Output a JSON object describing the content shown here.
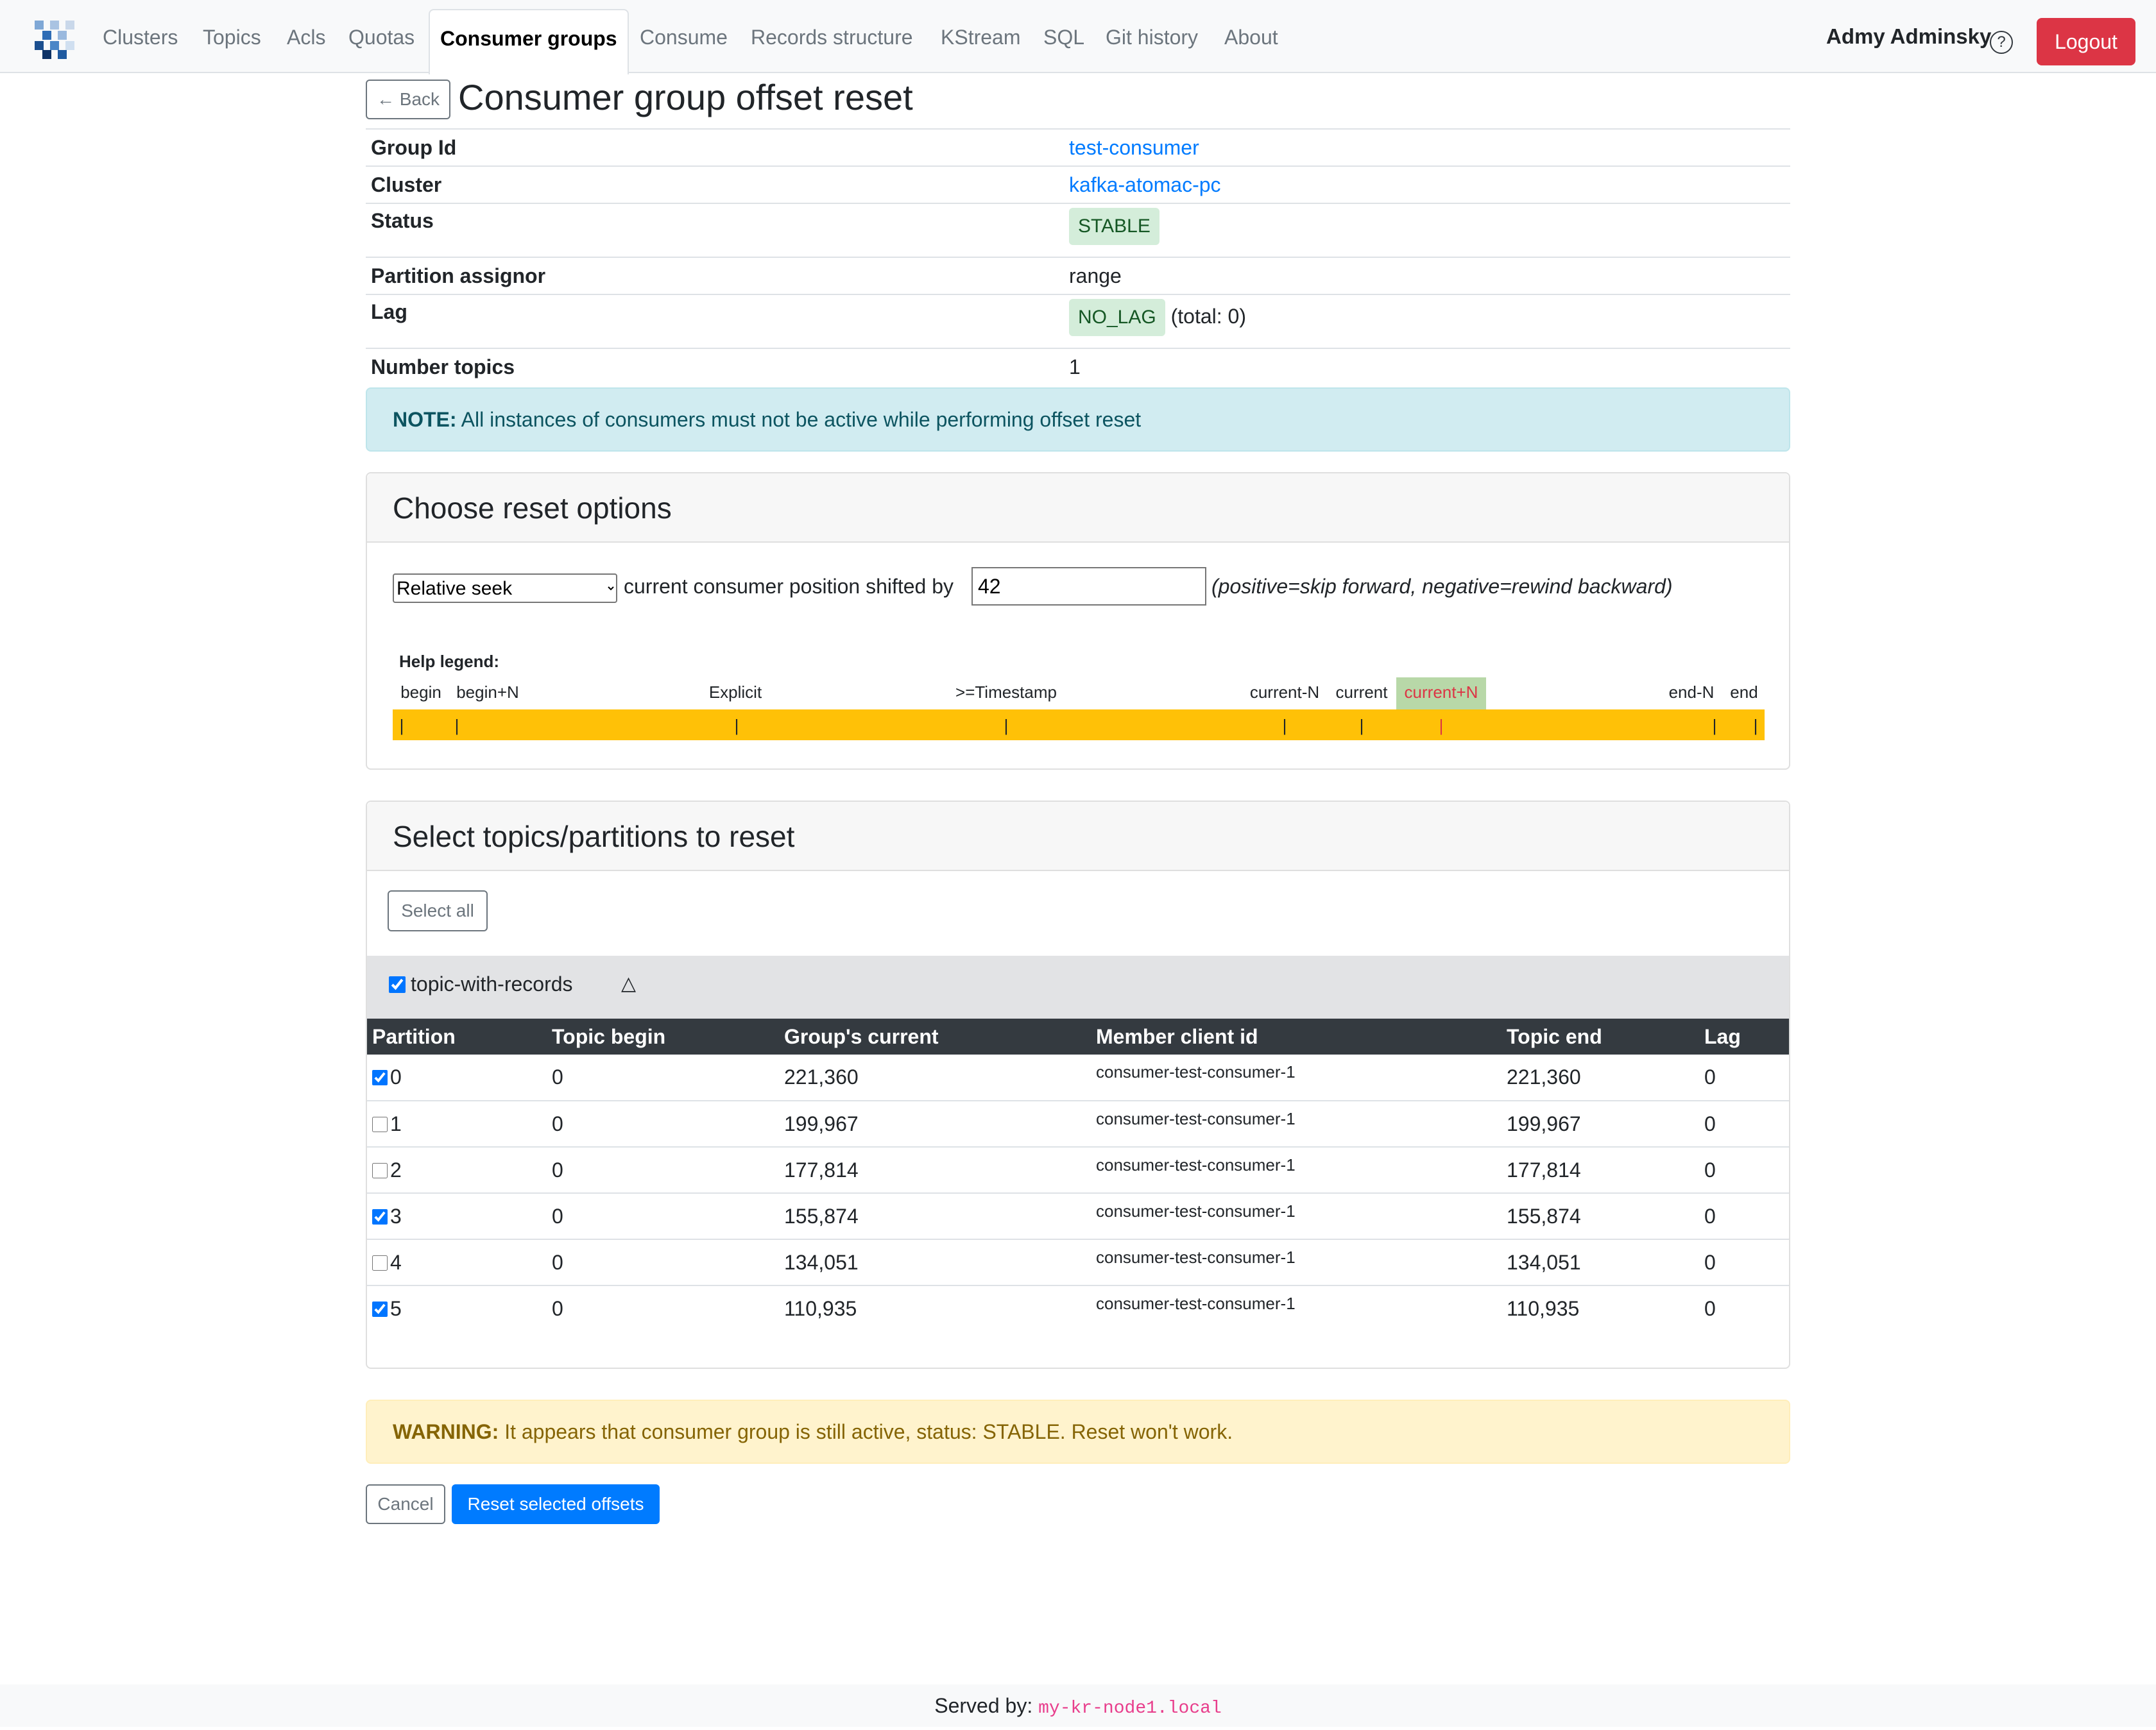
{
  "nav": {
    "items": [
      "Clusters",
      "Topics",
      "Acls",
      "Quotas",
      "Consumer groups",
      "Consume",
      "Records structure",
      "KStream",
      "SQL",
      "Git history",
      "About"
    ],
    "active": "Consumer groups",
    "user": "Admy Adminsky",
    "help_glyph": "?",
    "logout_label": "Logout"
  },
  "page": {
    "back_label": "← Back",
    "title": "Consumer group offset reset"
  },
  "group": {
    "group_id_label": "Group Id",
    "group_id": "test-consumer",
    "cluster_label": "Cluster",
    "cluster": "kafka-atomac-pc",
    "status_label": "Status",
    "status": "STABLE",
    "assignor_label": "Partition assignor",
    "assignor": "range",
    "lag_label": "Lag",
    "lag_status": "NO_LAG",
    "lag_total": "(total: 0)",
    "num_topics_label": "Number topics",
    "num_topics": "1"
  },
  "note": {
    "prefix": "NOTE:",
    "text": " All instances of consumers must not be active while performing offset reset"
  },
  "reset_options": {
    "header": "Choose reset options",
    "selected_mode": "Relative seek",
    "shift_label": "current consumer position shifted by",
    "shift_value": "42",
    "hint": "(positive=skip forward, negative=rewind backward)",
    "legend_title": "Help legend:",
    "legend_labels": [
      "begin",
      "begin+N",
      "Explicit",
      ">=Timestamp",
      "current-N",
      "current",
      "current+N",
      "end-N",
      "end"
    ],
    "tick_glyph": "|",
    "highlighted": "current+N"
  },
  "topics_section": {
    "header": "Select topics/partitions to reset",
    "select_all_label": "Select all",
    "topic_name": "topic-with-records",
    "topic_checked": true,
    "collapse_glyph": "△",
    "columns": [
      "Partition",
      "Topic begin",
      "Group's current",
      "Member client id",
      "Topic end",
      "Lag"
    ],
    "rows": [
      {
        "partition": "0",
        "checked": true,
        "begin": "0",
        "current": "221,360",
        "member": "consumer-test-consumer-1",
        "end": "221,360",
        "lag": "0"
      },
      {
        "partition": "1",
        "checked": false,
        "begin": "0",
        "current": "199,967",
        "member": "consumer-test-consumer-1",
        "end": "199,967",
        "lag": "0"
      },
      {
        "partition": "2",
        "checked": false,
        "begin": "0",
        "current": "177,814",
        "member": "consumer-test-consumer-1",
        "end": "177,814",
        "lag": "0"
      },
      {
        "partition": "3",
        "checked": true,
        "begin": "0",
        "current": "155,874",
        "member": "consumer-test-consumer-1",
        "end": "155,874",
        "lag": "0"
      },
      {
        "partition": "4",
        "checked": false,
        "begin": "0",
        "current": "134,051",
        "member": "consumer-test-consumer-1",
        "end": "134,051",
        "lag": "0"
      },
      {
        "partition": "5",
        "checked": true,
        "begin": "0",
        "current": "110,935",
        "member": "consumer-test-consumer-1",
        "end": "110,935",
        "lag": "0"
      }
    ]
  },
  "warning": {
    "prefix": "WARNING:",
    "text": " It appears that consumer group is still active, status: STABLE. Reset won't work."
  },
  "actions": {
    "cancel_label": "Cancel",
    "reset_label": "Reset selected offsets"
  },
  "footer": {
    "label": "Served by: ",
    "node": "my-kr-node1.local"
  },
  "colors": {
    "primary": "#007bff",
    "danger": "#dc3545",
    "legend_bar": "#ffc107",
    "legend_highlight": "#b8d8a8",
    "success_bg": "#d4edda",
    "info_bg": "#d1ecf1",
    "warning_bg": "#fff3cd"
  }
}
